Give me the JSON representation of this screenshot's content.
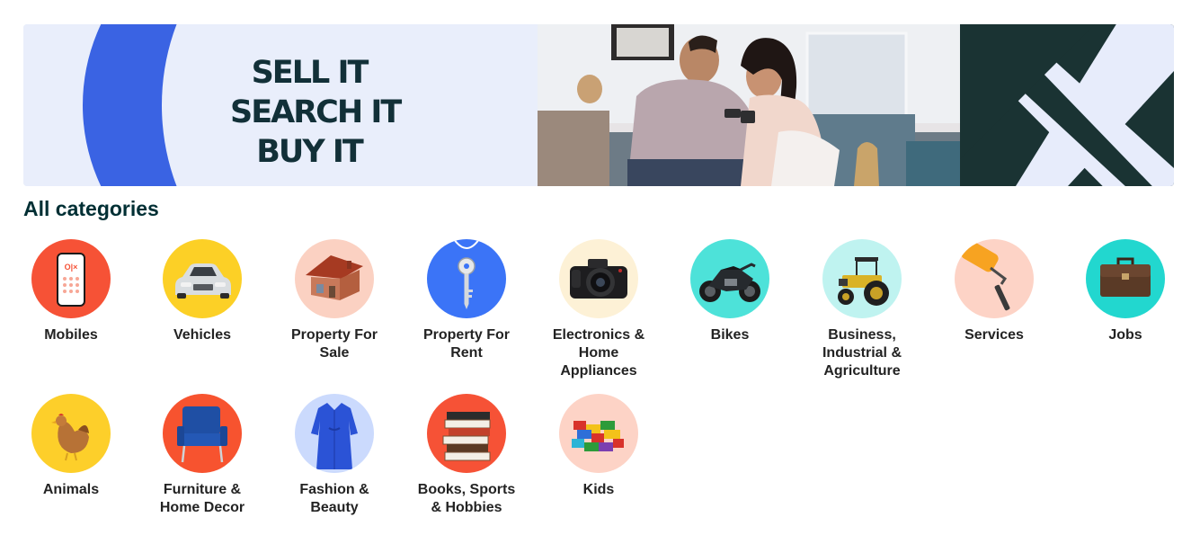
{
  "banner": {
    "slogan": [
      "SELL IT",
      "SEARCH IT",
      "BUY IT"
    ]
  },
  "heading": "All categories",
  "categories": [
    {
      "label": "Mobiles",
      "icon": "mobile-phone-icon",
      "color": "#f65236"
    },
    {
      "label": "Vehicles",
      "icon": "car-icon",
      "color": "#fcd026"
    },
    {
      "label": "Property For Sale",
      "icon": "house-icon",
      "color": "#fbd1c2"
    },
    {
      "label": "Property For Rent",
      "icon": "key-icon",
      "color": "#3b74f7"
    },
    {
      "label": "Electronics & Home Appliances",
      "icon": "camera-icon",
      "color": "#fdf1d6"
    },
    {
      "label": "Bikes",
      "icon": "motorcycle-icon",
      "color": "#4de2d9"
    },
    {
      "label": "Business, Industrial & Agriculture",
      "icon": "tractor-icon",
      "color": "#bff3f0"
    },
    {
      "label": "Services",
      "icon": "paint-roller-icon",
      "color": "#fdd3c6"
    },
    {
      "label": "Jobs",
      "icon": "briefcase-icon",
      "color": "#22d7cf"
    },
    {
      "label": "Animals",
      "icon": "hen-icon",
      "color": "#fdcf2a"
    },
    {
      "label": "Furniture & Home Decor",
      "icon": "chair-icon",
      "color": "#f7532f"
    },
    {
      "label": "Fashion & Beauty",
      "icon": "dress-icon",
      "color": "#cbdafd"
    },
    {
      "label": "Books, Sports & Hobbies",
      "icon": "books-icon",
      "color": "#f65236"
    },
    {
      "label": "Kids",
      "icon": "toy-blocks-icon",
      "color": "#fdd3c6"
    }
  ]
}
